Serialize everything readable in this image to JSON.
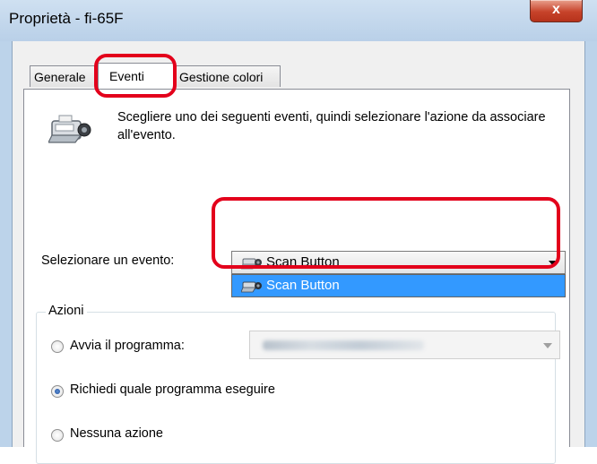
{
  "window": {
    "title": "Proprietà - fi-65F",
    "close_glyph": "x"
  },
  "tabs": [
    {
      "label": "Generale"
    },
    {
      "label": "Eventi"
    },
    {
      "label": "Gestione colori"
    }
  ],
  "events_tab": {
    "description": "Scegliere uno dei seguenti eventi, quindi selezionare l'azione da associare all'evento.",
    "select_event_label": "Selezionare un evento:",
    "selected_event": "Scan Button",
    "dropdown_options": [
      "Scan Button"
    ],
    "actions_group_label": "Azioni",
    "radio_options": [
      {
        "label": "Avvia il programma:",
        "checked": false
      },
      {
        "label": "Richiedi quale programma eseguire",
        "checked": true
      },
      {
        "label": "Nessuna azione",
        "checked": false
      }
    ]
  },
  "colors": {
    "highlight": "#e3001b",
    "selection": "#3399ff",
    "close_button": "#c7432a"
  },
  "icons": {
    "scanner": "scanner-icon",
    "close": "close-icon",
    "dropdown": "chevron-down-icon"
  }
}
